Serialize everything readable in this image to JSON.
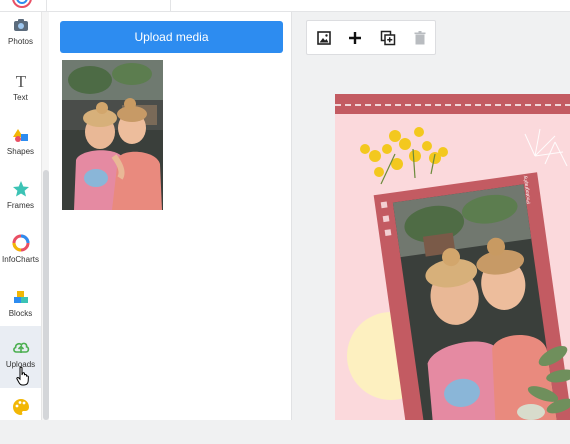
{
  "sidebar": {
    "items": [
      {
        "label": "Photos",
        "icon": "camera-icon"
      },
      {
        "label": "Text",
        "icon": "text-icon"
      },
      {
        "label": "Shapes",
        "icon": "shapes-icon"
      },
      {
        "label": "Frames",
        "icon": "frames-icon"
      },
      {
        "label": "InfoCharts",
        "icon": "infocharts-icon"
      },
      {
        "label": "Blocks",
        "icon": "blocks-icon"
      },
      {
        "label": "Uploads",
        "icon": "cloud-upload-icon",
        "active": true
      },
      {
        "label": "",
        "icon": "palette-icon"
      }
    ]
  },
  "media": {
    "upload_label": "Upload media"
  },
  "toolbar": {
    "buttons": [
      "add-image-icon",
      "plus-icon",
      "duplicate-icon",
      "trash-icon"
    ]
  },
  "canvas": {
    "photo_tag": "Photography"
  },
  "colors": {
    "primary": "#2d8cf0",
    "canvas_bg": "#fbd9dc",
    "frame": "#c35b62",
    "banner": "#c35b62"
  }
}
